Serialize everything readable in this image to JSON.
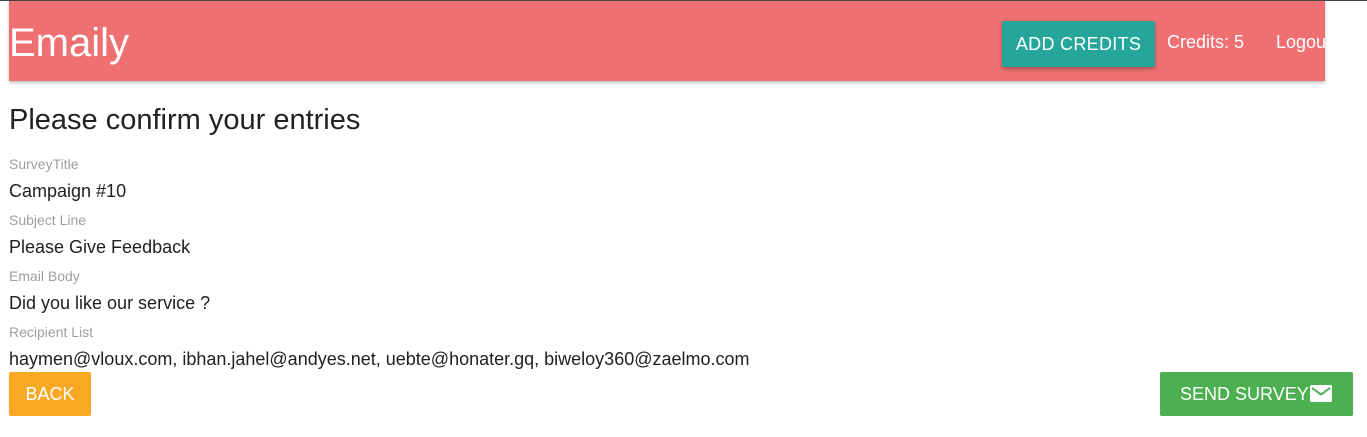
{
  "navbar": {
    "brand": "Emaily",
    "add_credits_label": "ADD CREDITS",
    "credits_text": "Credits: 5",
    "logout_label": "Logout",
    "colors": {
      "navbar_bg": "#ef7073",
      "add_credits_bg": "#26a69a"
    }
  },
  "main": {
    "heading": "Please confirm your entries",
    "fields": [
      {
        "label": "SurveyTitle",
        "value": "Campaign #10"
      },
      {
        "label": "Subject Line",
        "value": "Please Give Feedback"
      },
      {
        "label": "Email Body",
        "value": "Did you like our service ?"
      },
      {
        "label": "Recipient List",
        "value": "haymen@vloux.com, ibhan.jahel@andyes.net, uebte@honater.gq, biweloy360@zaelmo.com"
      }
    ]
  },
  "actions": {
    "back_label": "BACK",
    "send_label": "SEND SURVEY",
    "send_icon": "email-icon",
    "colors": {
      "back_bg": "#f9a825",
      "send_bg": "#4caf50"
    }
  }
}
